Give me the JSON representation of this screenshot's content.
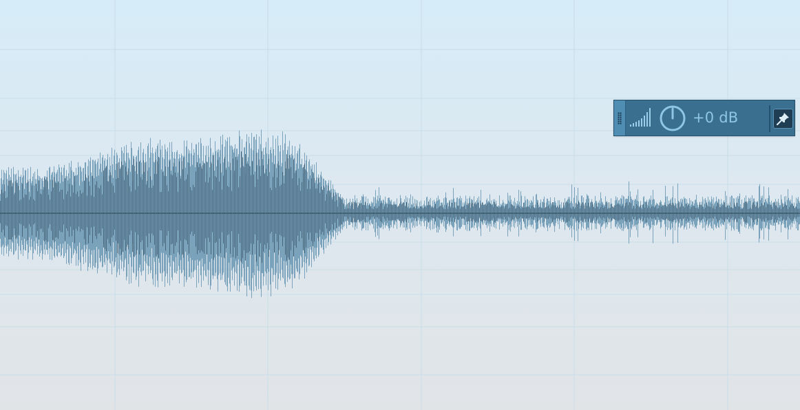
{
  "gain_hud": {
    "value_label": "+0 dB",
    "icons": {
      "grip": "drag-grip-icon",
      "level": "volume-level-icon",
      "knob": "gain-knob-icon",
      "pin": "pin-icon"
    }
  },
  "colors": {
    "background_top": "#d6ecf8",
    "background_bottom": "#e1e4e7",
    "gridline": "#c9dde8",
    "waveform": "#3d5a6e",
    "waveform_light": "#6f9ab5",
    "hud_background": "#3a6f90",
    "hud_accent": "#8fc6e6"
  }
}
